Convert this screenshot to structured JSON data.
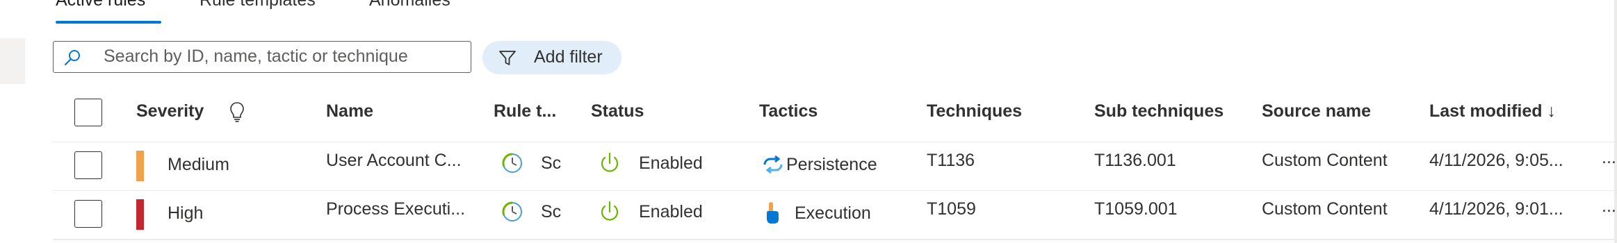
{
  "tabs": [
    {
      "label": "Active rules",
      "selected": true
    },
    {
      "label": "Rule templates",
      "selected": false
    },
    {
      "label": "Anomalies",
      "selected": false
    }
  ],
  "search": {
    "placeholder": "Search by ID, name, tactic or technique",
    "value": ""
  },
  "add_filter_label": "Add filter",
  "columns": {
    "severity": "Severity",
    "name": "Name",
    "rule_type": "Rule t...",
    "status": "Status",
    "tactics": "Tactics",
    "techniques": "Techniques",
    "sub_techniques": "Sub techniques",
    "source_name": "Source name",
    "last_modified": "Last modified ↓"
  },
  "rows": [
    {
      "severity": "Medium",
      "severity_color": "#f2a24b",
      "name": "User Account C...",
      "rule_type": "Sch",
      "status": "Enabled",
      "tactic": "Persistence",
      "tactic_icon": "persistence-icon",
      "technique": "T1136",
      "sub_technique": "T1136.001",
      "source_name": "Custom Content",
      "last_modified": "4/11/2026, 9:05...",
      "more": "..."
    },
    {
      "severity": "High",
      "severity_color": "#c4262e",
      "name": "Process Executi...",
      "rule_type": "Sch",
      "status": "Enabled",
      "tactic": "Execution",
      "tactic_icon": "execution-icon",
      "technique": "T1059",
      "sub_technique": "T1059.001",
      "source_name": "Custom Content",
      "last_modified": "4/11/2026, 9:01...",
      "more": "..."
    }
  ],
  "colors": {
    "accent": "#0078d4",
    "enabled_green": "#6bb700",
    "filter_bg": "#e1eef9"
  }
}
